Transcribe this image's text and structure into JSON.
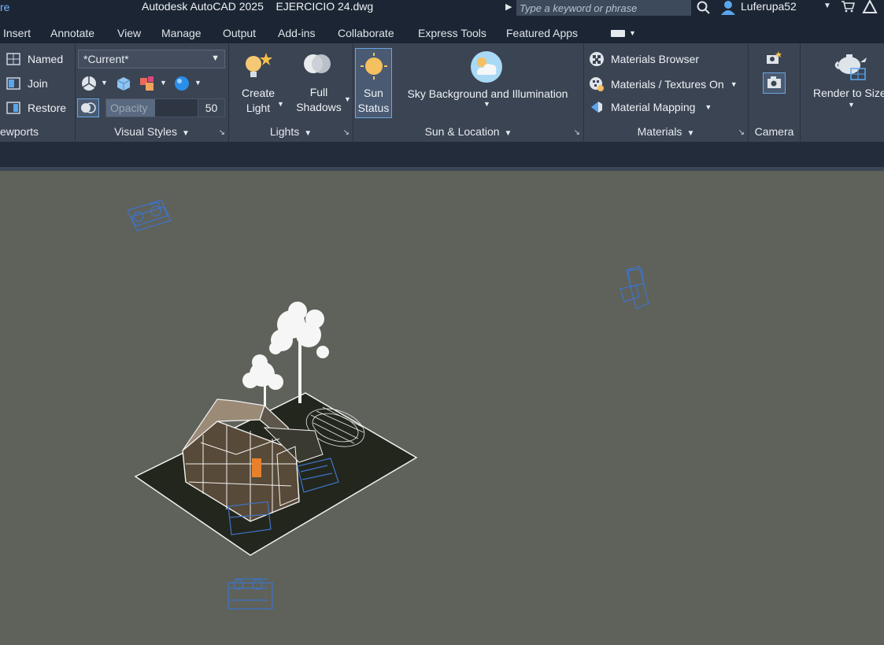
{
  "titlebar": {
    "left_fragment": "re",
    "title": "Autodesk AutoCAD 2025    EJERCICIO 24.dwg",
    "search_placeholder": "Type a keyword or phrase",
    "user": "Luferupa52",
    "icons": [
      "search-icon",
      "user-icon",
      "cart-icon",
      "autodesk-icon"
    ]
  },
  "menu": {
    "tabs": [
      "Insert",
      "Annotate",
      "View",
      "Manage",
      "Output",
      "Add-ins",
      "Collaborate",
      "Express Tools",
      "Featured Apps"
    ]
  },
  "ribbon": {
    "viewports": {
      "title": "ewports",
      "named": "Named",
      "join": "Join",
      "restore": "Restore"
    },
    "visual_styles": {
      "title": "Visual Styles",
      "current": "*Current*",
      "opacity_label": "Opacity",
      "opacity_value": "50"
    },
    "lights": {
      "title": "Lights",
      "create_light_1": "Create",
      "create_light_2": "Light",
      "full_shadows_1": "Full",
      "full_shadows_2": "Shadows"
    },
    "sun_location": {
      "title": "Sun & Location",
      "sun_status_1": "Sun",
      "sun_status_2": "Status",
      "sky": "Sky Background and Illumination"
    },
    "materials": {
      "title": "Materials",
      "browser": "Materials Browser",
      "textures": "Materials / Textures On",
      "mapping": "Material Mapping"
    },
    "camera": {
      "title": "Camera"
    },
    "render": {
      "label": "Render to Size"
    }
  },
  "colors": {
    "accent": "#6aa6e0",
    "ribbon_bg": "#3b4453",
    "titlebar_bg": "#1c2533",
    "viewport_bg": "#5f625a"
  }
}
